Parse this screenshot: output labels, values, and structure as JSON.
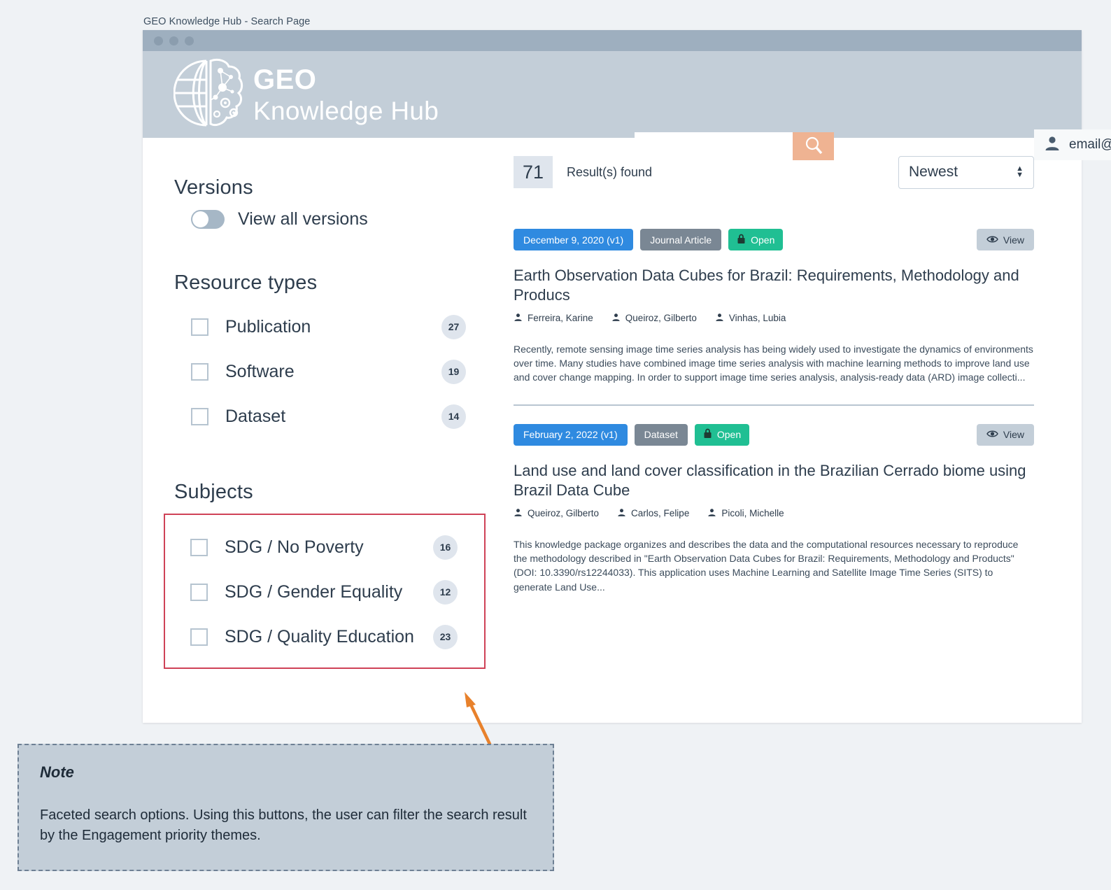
{
  "window": {
    "caption": "GEO Knowledge Hub - Search Page"
  },
  "header": {
    "brand_top": "GEO",
    "brand_bottom": "Knowledge Hub",
    "logo_icon": "globe-brain-logo",
    "search": {
      "value": "",
      "placeholder": "",
      "button_icon": "search-icon"
    },
    "user": {
      "avatar_icon": "user-icon",
      "email": "email@mail.org",
      "caret_icon": "caret-down-icon"
    }
  },
  "sidebar": {
    "versions": {
      "title": "Versions",
      "toggle_label": "View all versions",
      "toggle_on": false
    },
    "resource_types": {
      "title": "Resource types",
      "items": [
        {
          "label": "Publication",
          "count": "27",
          "checked": false
        },
        {
          "label": "Software",
          "count": "19",
          "checked": false
        },
        {
          "label": "Dataset",
          "count": "14",
          "checked": false
        }
      ]
    },
    "subjects": {
      "title": "Subjects",
      "highlight_color": "#cf4257",
      "items": [
        {
          "label": "SDG / No Poverty",
          "count": "16",
          "checked": false
        },
        {
          "label": "SDG / Gender Equality",
          "count": "12",
          "checked": false
        },
        {
          "label": "SDG / Quality Education",
          "count": "23",
          "checked": false
        }
      ]
    }
  },
  "results_header": {
    "count": "71",
    "count_label": "Result(s) found",
    "sort_value": "Newest",
    "sort_options": [
      "Newest"
    ]
  },
  "results": [
    {
      "date_badge": "December 9, 2020 (v1)",
      "type_badge": "Journal Article",
      "access_badge": "Open",
      "access_icon": "lock-icon",
      "view_label": "View",
      "view_icon": "eye-icon",
      "title": "Earth Observation Data Cubes for Brazil: Requirements, Methodology and Producs",
      "authors": [
        "Ferreira, Karine",
        "Queiroz, Gilberto",
        "Vinhas, Lubia"
      ],
      "abstract": "Recently, remote sensing image time series analysis has being widely used to investigate the dynamics of environments over time. Many studies have combined image time series analysis with machine learning methods to improve land use and cover change mapping. In order to support image time series analysis, analysis-ready data (ARD) image collecti..."
    },
    {
      "date_badge": "February 2, 2022 (v1)",
      "type_badge": "Dataset",
      "access_badge": "Open",
      "access_icon": "lock-icon",
      "view_label": "View",
      "view_icon": "eye-icon",
      "title": "Land use and land cover classification in the Brazilian Cerrado biome using Brazil Data Cube",
      "authors": [
        "Queiroz, Gilberto",
        "Carlos, Felipe",
        "Picoli, Michelle"
      ],
      "abstract": "This knowledge package organizes and describes the data and the computational resources necessary to reproduce the methodology described in \"Earth Observation Data Cubes for Brazil: Requirements, Methodology and Products\" (DOI: 10.3390/rs12244033). This application uses Machine Learning and Satellite Image Time Series (SITS) to generate Land Use..."
    }
  ],
  "annotation": {
    "title": "Note",
    "text": "Faceted search options. Using this buttons, the user can filter the search result by the Engagement priority themes.",
    "marker_color": "#e8812b"
  },
  "colors": {
    "page_bg": "#eff2f5",
    "header_bg": "#c3ced8",
    "titlebar_bg": "#9eafbf",
    "accent_orange": "#efb392",
    "badge_blue": "#2f8ae0",
    "badge_gray": "#7a8794",
    "badge_green": "#20bf93"
  }
}
